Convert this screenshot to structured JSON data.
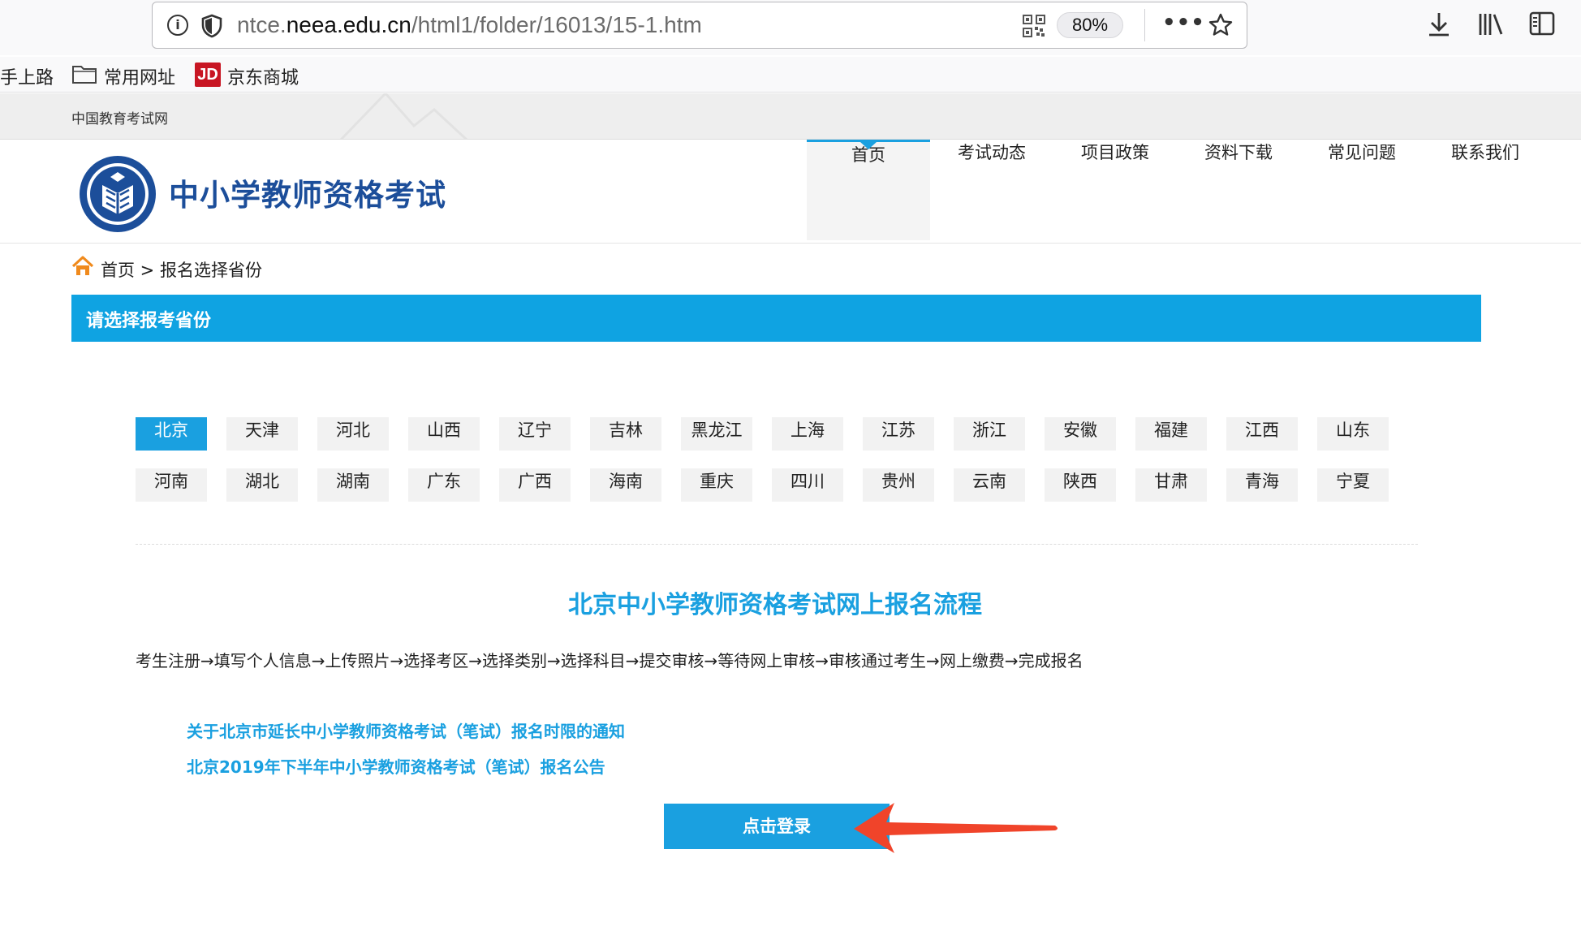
{
  "browser": {
    "url_prefix": "ntce.",
    "url_domain": "neea.edu.cn",
    "url_path": "/html1/folder/16013/15-1.htm",
    "zoom": "80%",
    "bookmarks": [
      "手上路",
      "常用网址",
      "京东商城"
    ],
    "jd_logo": "JD"
  },
  "site": {
    "topbar_label": "中国教育考试网",
    "logo_text": "中小学教师资格考试",
    "nav": [
      "首页",
      "考试动态",
      "项目政策",
      "资料下载",
      "常见问题",
      "联系我们"
    ],
    "nav_active_index": 0,
    "accent_color": "#1aa0e0"
  },
  "breadcrumb": {
    "text": "首页 > 报名选择省份"
  },
  "section_title": "请选择报考省份",
  "provinces": {
    "row1": [
      "北京",
      "天津",
      "河北",
      "山西",
      "辽宁",
      "吉林",
      "黑龙江",
      "上海",
      "江苏",
      "浙江",
      "安徽",
      "福建",
      "江西",
      "山东"
    ],
    "row2": [
      "河南",
      "湖北",
      "湖南",
      "广东",
      "广西",
      "海南",
      "重庆",
      "四川",
      "贵州",
      "云南",
      "陕西",
      "甘肃",
      "青海",
      "宁夏"
    ],
    "selected": "北京"
  },
  "flow": {
    "title": "北京中小学教师资格考试网上报名流程",
    "steps": "考生注册→填写个人信息→上传照片→选择考区→选择类别→选择科目→提交审核→等待网上审核→审核通过考生→网上缴费→完成报名"
  },
  "notices": [
    "关于北京市延长中小学教师资格考试（笔试）报名时限的通知",
    "北京2019年下半年中小学教师资格考试（笔试）报名公告"
  ],
  "login_button": "点击登录",
  "annotation_color": "#f0442a"
}
